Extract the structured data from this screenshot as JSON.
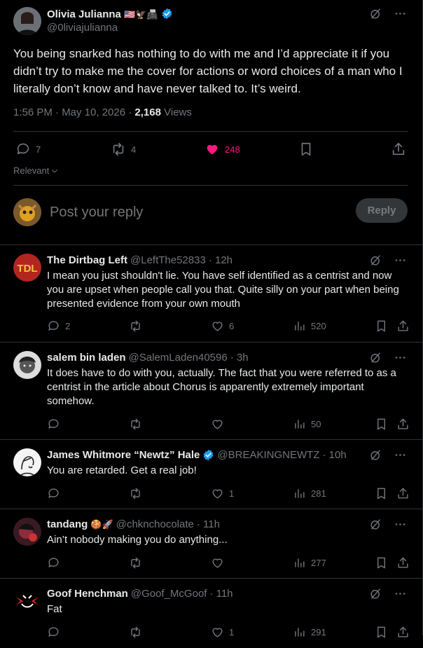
{
  "main_tweet": {
    "name": "Olivia Julianna",
    "emoji": "🇺🇸🦅📠",
    "handle": "@0liviajulianna",
    "text": "You being snarked has nothing to do with me and I’d appreciate it if you didn’t try to make me the cover for  actions or word choices of a man who I literally don’t know and have never talked to. It’s weird.",
    "timestamp": "1:56 PM · May 10, 2026 ·",
    "views_count": "2,168",
    "views_label": "Views",
    "replies": "7",
    "reposts": "4",
    "likes": "248",
    "like_color": "#f91880",
    "verified_color": "#1d9bf0"
  },
  "sort": {
    "label": "Relevant"
  },
  "reply_composer": {
    "placeholder": "Post your reply",
    "button": "Reply"
  },
  "replies": [
    {
      "name": "The Dirtbag Left",
      "handle": "@LeftThe52833",
      "time": "· 12h",
      "text": "I mean you just shouldn't lie.  You have self identified as a centrist and now you are upset when people call you that. Quite silly on your part when being presented evidence from your own mouth",
      "replies": "2",
      "reposts": "",
      "likes": "6",
      "views": "520"
    },
    {
      "name": "salem bin laden",
      "handle": "@SalemLaden40596",
      "time": "· 3h",
      "text": "It does have to do with you, actually.  The fact that you were referred to as a centrist in the article about Chorus is apparently extremely important somehow.",
      "replies": "",
      "reposts": "",
      "likes": "",
      "views": "50"
    },
    {
      "name": "James Whitmore “Newtz” Hale",
      "handle": "@BREAKINGNEWTZ",
      "time": "· 10h",
      "text": "You are retarded. Get a real job!",
      "replies": "",
      "reposts": "",
      "likes": "1",
      "views": "281"
    },
    {
      "name": "tandang",
      "emoji": "🍪🚀",
      "handle": "@chknchocolate",
      "time": "· 11h",
      "text": "Ain’t nobody making you do anything...",
      "replies": "",
      "reposts": "",
      "likes": "",
      "views": "277"
    },
    {
      "name": "Goof Henchman",
      "handle": "@Goof_McGoof",
      "time": "· 11h",
      "text": "Fat",
      "replies": "",
      "reposts": "",
      "likes": "1",
      "views": "291"
    }
  ]
}
